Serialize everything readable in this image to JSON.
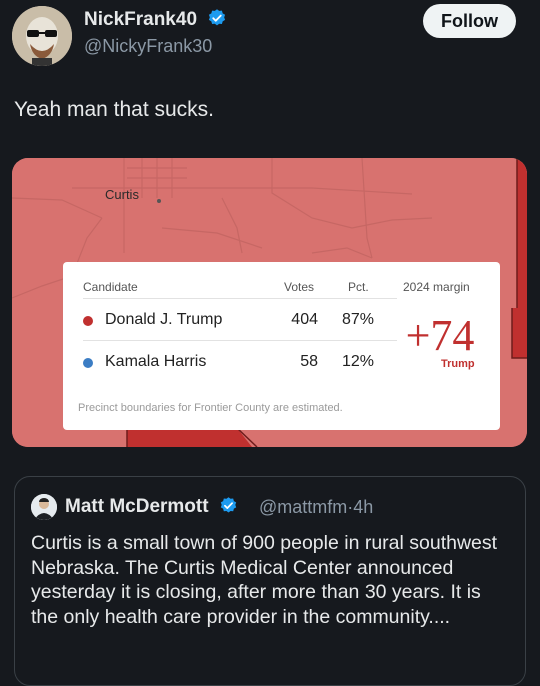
{
  "author": {
    "display_name": "NickFrank40",
    "handle": "@NickyFrank30",
    "verified": true
  },
  "follow_label": "Follow",
  "tweet_text": "Yeah man that sucks.",
  "map": {
    "town_label": "Curtis",
    "header": {
      "candidate": "Candidate",
      "votes": "Votes",
      "pct": "Pct.",
      "margin": "2024 margin"
    },
    "rows": [
      {
        "name": "Donald J. Trump",
        "votes": "404",
        "pct": "87%",
        "color": "#c0302f"
      },
      {
        "name": "Kamala Harris",
        "votes": "58",
        "pct": "12%",
        "color": "#3b7dc4"
      }
    ],
    "margin_value": "+74",
    "margin_winner": "Trump",
    "footnote": "Precinct boundaries for Frontier County are estimated.",
    "fill_color": "#d8726f",
    "dark_fill_color": "#c0302f"
  },
  "quoted": {
    "display_name": "Matt McDermott",
    "handle": "@mattmfm",
    "separator": "·",
    "time": "4h",
    "verified": true,
    "text": "Curtis is a small town of 900 people in rural southwest Nebraska. The Curtis Medical Center announced yesterday it is closing, after more than 30 years. It is the only health care provider in the community...."
  },
  "colors": {
    "background": "#16191e",
    "verified_blue": "#1d9bf0",
    "secondary_text": "#8b98a5"
  }
}
